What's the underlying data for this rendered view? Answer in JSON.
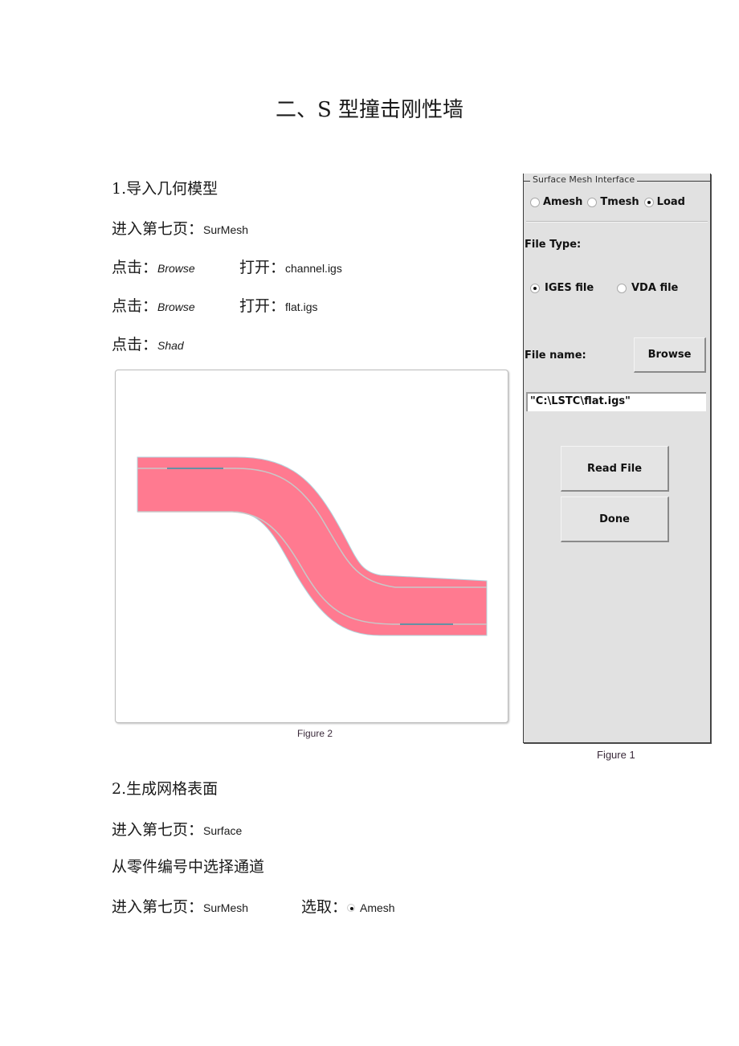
{
  "title": "二、S 型撞击刚性墙",
  "section1": {
    "heading": "1.导入几何模型",
    "steps": [
      {
        "prefix": "进入第七页：",
        "value": "SurMesh"
      },
      {
        "prefix": "点击：",
        "value": "Browse",
        "prefix2": "打开：",
        "value2": "channel.igs"
      },
      {
        "prefix": "点击：",
        "value": "Browse",
        "prefix2": "打开：",
        "value2": "flat.igs"
      },
      {
        "prefix": "点击：",
        "value": "Shad"
      }
    ]
  },
  "figure2": {
    "caption": "Figure 2",
    "fill_color": "#ff7a90",
    "edge_color": "#b0d8e0"
  },
  "panel": {
    "legend": "Surface Mesh Interface",
    "mode_options": [
      {
        "label": "Amesh",
        "selected": false
      },
      {
        "label": "Tmesh",
        "selected": false
      },
      {
        "label": "Load",
        "selected": true
      }
    ],
    "file_type_label": "File Type:",
    "file_type_options": [
      {
        "label": "IGES file",
        "selected": true
      },
      {
        "label": "VDA file",
        "selected": false
      }
    ],
    "file_name_label": "File name:",
    "browse_label": "Browse",
    "file_name_value": "\"C:\\LSTC\\flat.igs\"",
    "read_file_label": "Read File",
    "done_label": "Done",
    "caption": "Figure 1"
  },
  "section2": {
    "heading": "2.生成网格表面",
    "step1": {
      "prefix": "进入第七页：",
      "value": "Surface"
    },
    "step2": "从零件编号中选择通道",
    "step3": {
      "prefix": "进入第七页：",
      "value": "SurMesh",
      "prefix2": "选取：",
      "value2": "Amesh"
    }
  }
}
